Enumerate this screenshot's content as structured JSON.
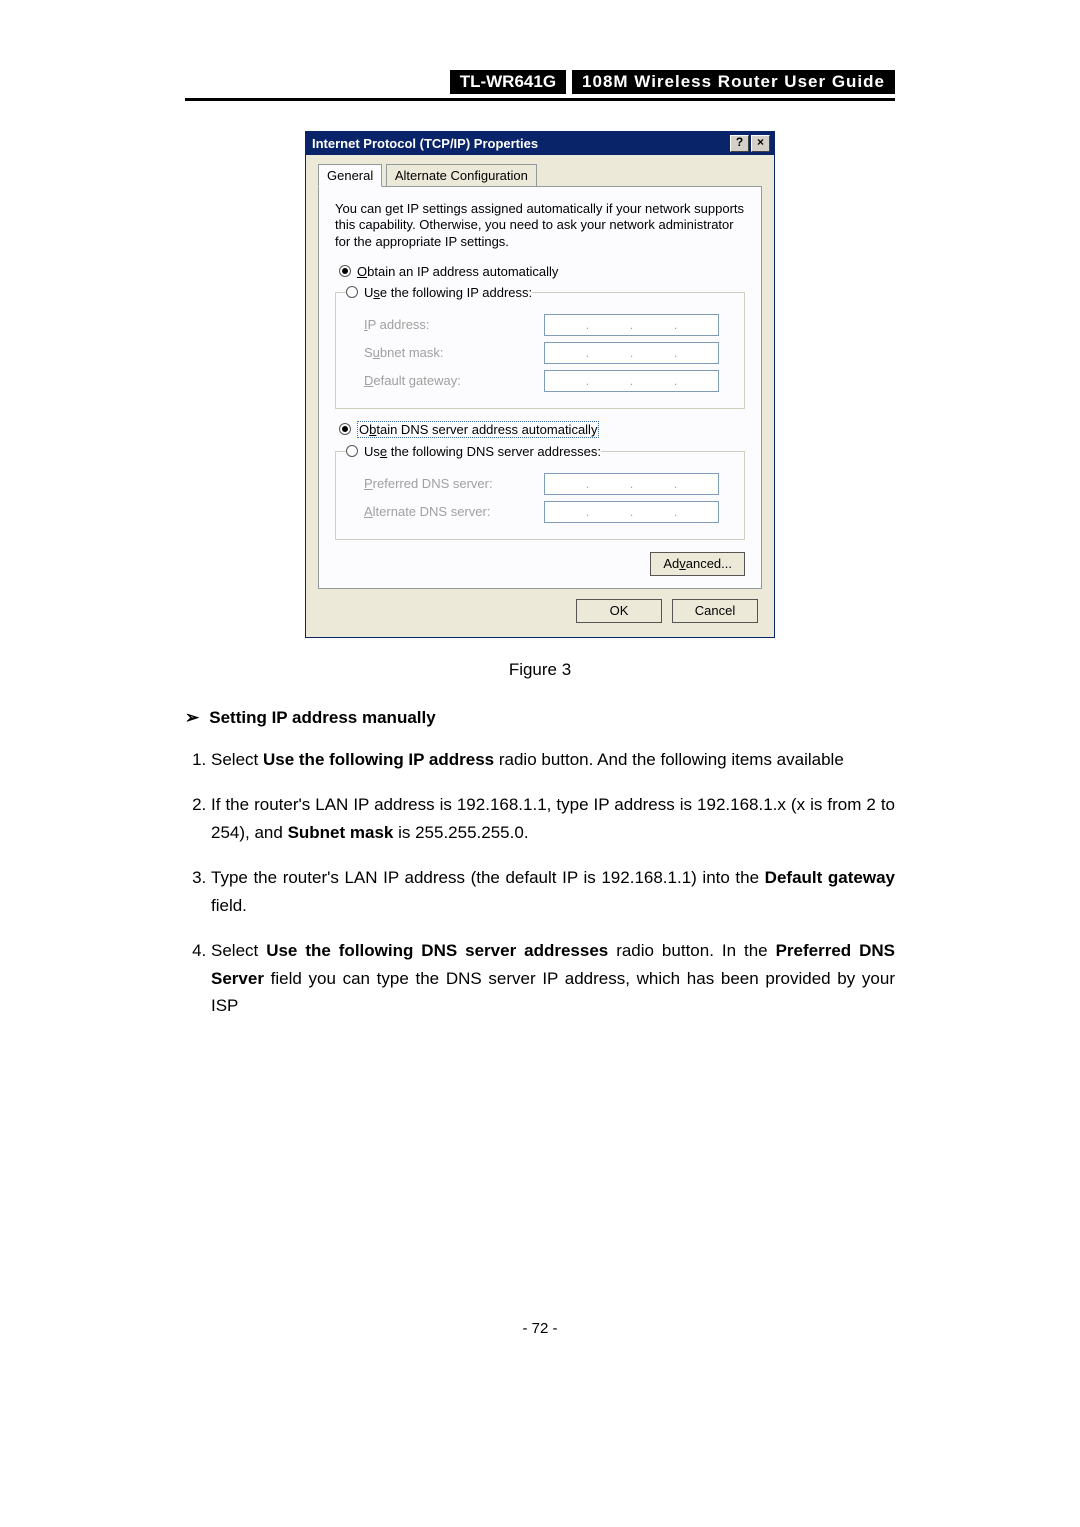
{
  "header": {
    "model": "TL-WR641G",
    "title": "108M  Wireless  Router  User  Guide"
  },
  "dialog": {
    "title": "Internet Protocol (TCP/IP) Properties",
    "help_glyph": "?",
    "close_glyph": "×",
    "tabs": {
      "general": "General",
      "alt": "Alternate Configuration"
    },
    "intro": "You can get IP settings assigned automatically if your network supports this capability. Otherwise, you need to ask your network administrator for the appropriate IP settings.",
    "radio": {
      "obtain_ip": "Obtain an IP address automatically",
      "use_ip": "Use the following IP address:",
      "obtain_dns": "Obtain DNS server address automatically",
      "use_dns": "Use the following DNS server addresses:"
    },
    "labels": {
      "ip": "IP address:",
      "subnet": "Subnet mask:",
      "gateway": "Default gateway:",
      "pref_dns": "Preferred DNS server:",
      "alt_dns": "Alternate DNS server:"
    },
    "buttons": {
      "advanced": "Advanced...",
      "ok": "OK",
      "cancel": "Cancel"
    }
  },
  "figure_label": "Figure 3",
  "section_heading": "Setting IP address manually",
  "steps": {
    "s1a": "Select ",
    "s1b": "Use the following IP address",
    "s1c": " radio button. And the following items available",
    "s2a": "If the router's LAN IP address is 192.168.1.1, type IP address is 192.168.1.x (x is from 2 to 254), and ",
    "s2b": "Subnet mask",
    "s2c": " is 255.255.255.0.",
    "s3a": "Type the router's LAN IP address (the default IP is 192.168.1.1) into the ",
    "s3b": "Default gateway",
    "s3c": " field.",
    "s4a": "Select ",
    "s4b": "Use the following DNS server addresses",
    "s4c": " radio button. In the ",
    "s4d": "Preferred DNS Server",
    "s4e": " field you can type the DNS server IP address, which has been provided by your ISP"
  },
  "page_number": "- 72 -"
}
